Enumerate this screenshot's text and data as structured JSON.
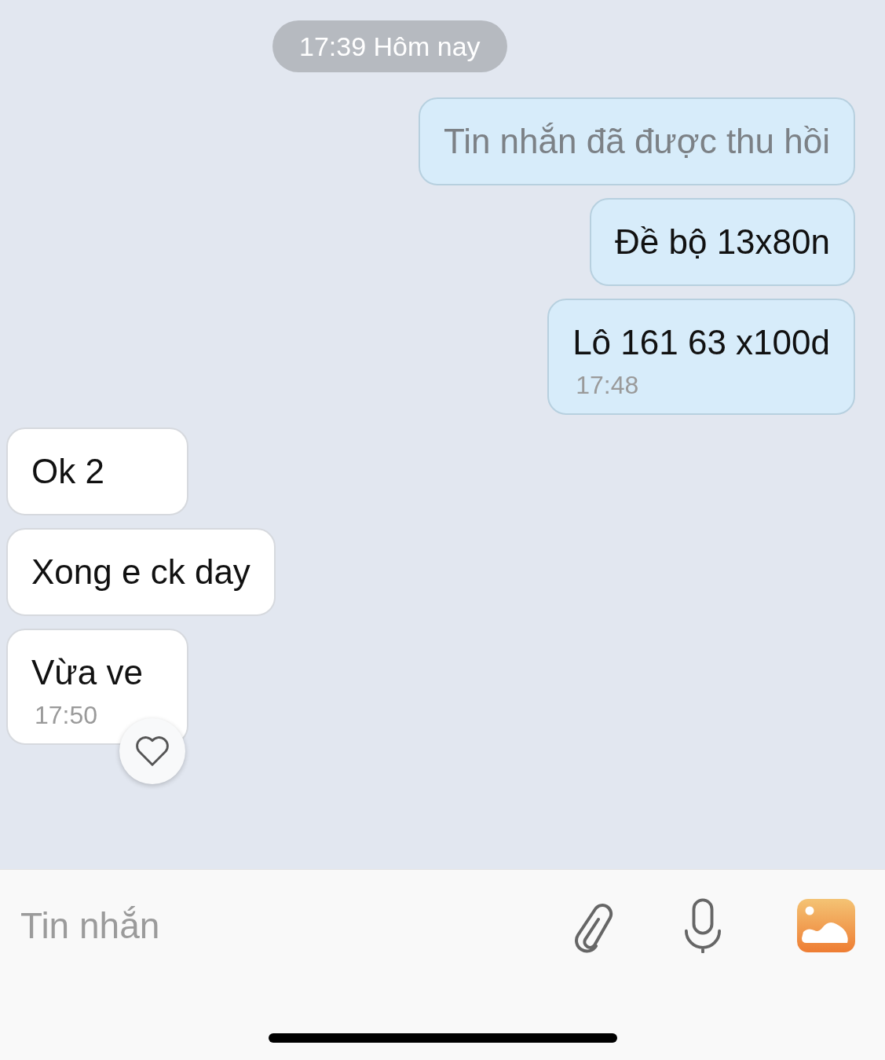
{
  "date_separator": "17:39 Hôm nay",
  "messages": [
    {
      "outgoing": true,
      "kind": "recalled",
      "text": "Tin nhắn đã được thu hồi",
      "reaction_button": false
    },
    {
      "outgoing": true,
      "kind": "text",
      "text": "Đề bộ 13x80n",
      "reaction_button": false
    },
    {
      "outgoing": true,
      "kind": "text",
      "text": "Lô 161 63 x100d",
      "time": "17:48",
      "reaction_button": false
    },
    {
      "outgoing": false,
      "kind": "text",
      "text": "Ok 2",
      "reaction_button": false
    },
    {
      "outgoing": false,
      "kind": "text",
      "text": "Xong e ck day",
      "reaction_button": false
    },
    {
      "outgoing": false,
      "kind": "text",
      "text": "Vừa ve",
      "time": "17:50",
      "reaction_button": true
    }
  ],
  "composer": {
    "placeholder": "Tin nhắn"
  }
}
